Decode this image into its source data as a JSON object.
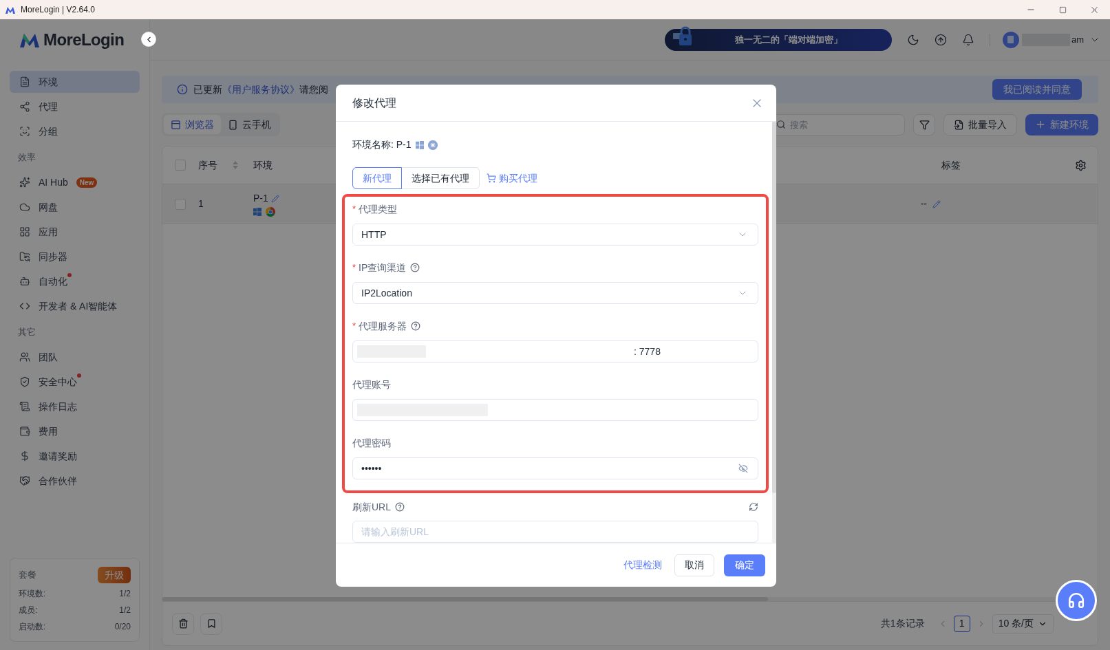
{
  "window": {
    "title": "MoreLogin | V2.64.0"
  },
  "sidebar": {
    "logo": "MoreLogin",
    "sections": [
      {
        "items": [
          {
            "label": "环境",
            "selected": true,
            "dot": false
          },
          {
            "label": "代理",
            "selected": false,
            "dot": false
          },
          {
            "label": "分组",
            "selected": false,
            "dot": false
          }
        ]
      },
      {
        "title": "效率",
        "items": [
          {
            "label": "AI Hub",
            "badge": "New",
            "selected": false,
            "dot": false
          },
          {
            "label": "网盘",
            "selected": false,
            "dot": false
          },
          {
            "label": "应用",
            "selected": false,
            "dot": false
          },
          {
            "label": "同步器",
            "selected": false,
            "dot": false
          },
          {
            "label": "自动化",
            "selected": false,
            "dot": true
          },
          {
            "label": "开发者 & AI智能体",
            "selected": false,
            "dot": false
          }
        ]
      },
      {
        "title": "其它",
        "items": [
          {
            "label": "团队",
            "selected": false,
            "dot": false
          },
          {
            "label": "安全中心",
            "selected": false,
            "dot": true
          },
          {
            "label": "操作日志",
            "selected": false,
            "dot": false
          },
          {
            "label": "费用",
            "selected": false,
            "dot": false
          },
          {
            "label": "邀请奖励",
            "selected": false,
            "dot": false
          },
          {
            "label": "合作伙伴",
            "selected": false,
            "dot": false
          }
        ]
      }
    ],
    "plan": {
      "title": "套餐",
      "upgrade": "升级",
      "rows": [
        {
          "label": "环境数:",
          "value": "1/2"
        },
        {
          "label": "成员:",
          "value": "1/2"
        },
        {
          "label": "启动数:",
          "value": "0/20"
        }
      ]
    }
  },
  "header": {
    "promo": "独一无二的「端对端加密」",
    "user": "am"
  },
  "notice": {
    "prefix": "已更新",
    "link": "《用户服务协议》",
    "suffix": "请您阅",
    "agree": "我已阅读并同意"
  },
  "tabs": [
    {
      "label": "浏览器",
      "selected": true
    },
    {
      "label": "云手机",
      "selected": false
    }
  ],
  "toolbar": {
    "search_placeholder": "搜索",
    "import": "批量导入",
    "new": "新建环境"
  },
  "table": {
    "all_checked": false,
    "columns": [
      "序号",
      "环境",
      "标签"
    ],
    "rows": [
      {
        "index": "1",
        "name": "P-1",
        "tags": "--",
        "checked": false
      }
    ]
  },
  "pagination": {
    "total": "共1条记录",
    "page": "1",
    "page_size": "10 条/页"
  },
  "modal": {
    "title": "修改代理",
    "env_label": "环境名称: P-1",
    "tabs": [
      {
        "label": "新代理",
        "selected": true
      },
      {
        "label": "选择已有代理",
        "selected": false
      }
    ],
    "buy": "购买代理",
    "fields": [
      {
        "kind": "select",
        "required_mark": "*",
        "label": "代理类型",
        "help": false,
        "value": "HTTP",
        "redacted": false
      },
      {
        "kind": "select",
        "required_mark": "*",
        "label": "IP查询渠道",
        "help": true,
        "value": "IP2Location",
        "redacted": false
      },
      {
        "kind": "text",
        "required_mark": "*",
        "label": "代理服务器",
        "help": true,
        "value": ": 7778",
        "redacted": true
      },
      {
        "kind": "text",
        "label": "代理账号",
        "help": false,
        "redacted": true
      },
      {
        "kind": "password",
        "label": "代理密码",
        "help": false,
        "value": "••••••",
        "redacted": false
      }
    ],
    "refresh": {
      "label": "刷新URL",
      "placeholder": "请输入刷新URL"
    },
    "check": "代理检测",
    "cancel": "取消",
    "ok": "确定"
  }
}
